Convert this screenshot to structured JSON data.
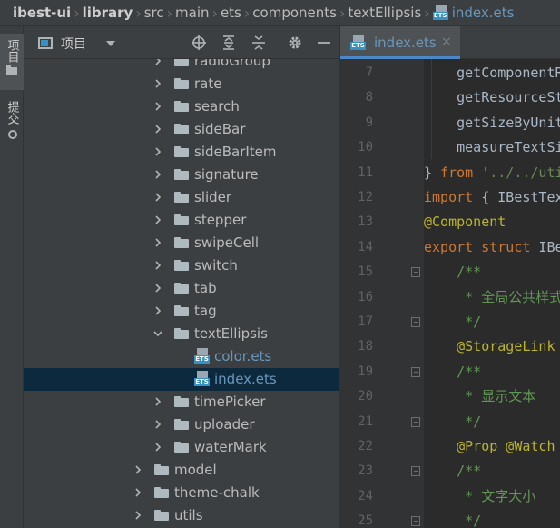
{
  "breadcrumb": {
    "items": [
      "ibest-ui",
      "library",
      "src",
      "main",
      "ets",
      "components",
      "textEllipsis",
      "index.ets"
    ]
  },
  "tool_strip": {
    "project_label": "项目",
    "commit_label": "提交"
  },
  "project_panel": {
    "title": "项目",
    "tree": [
      {
        "label": "radioGroup",
        "type": "folder",
        "depth": 2,
        "expanded": false,
        "selected": false
      },
      {
        "label": "rate",
        "type": "folder",
        "depth": 2,
        "expanded": false,
        "selected": false
      },
      {
        "label": "search",
        "type": "folder",
        "depth": 2,
        "expanded": false,
        "selected": false
      },
      {
        "label": "sideBar",
        "type": "folder",
        "depth": 2,
        "expanded": false,
        "selected": false
      },
      {
        "label": "sideBarItem",
        "type": "folder",
        "depth": 2,
        "expanded": false,
        "selected": false
      },
      {
        "label": "signature",
        "type": "folder",
        "depth": 2,
        "expanded": false,
        "selected": false
      },
      {
        "label": "slider",
        "type": "folder",
        "depth": 2,
        "expanded": false,
        "selected": false
      },
      {
        "label": "stepper",
        "type": "folder",
        "depth": 2,
        "expanded": false,
        "selected": false
      },
      {
        "label": "swipeCell",
        "type": "folder",
        "depth": 2,
        "expanded": false,
        "selected": false
      },
      {
        "label": "switch",
        "type": "folder",
        "depth": 2,
        "expanded": false,
        "selected": false
      },
      {
        "label": "tab",
        "type": "folder",
        "depth": 2,
        "expanded": false,
        "selected": false
      },
      {
        "label": "tag",
        "type": "folder",
        "depth": 2,
        "expanded": false,
        "selected": false
      },
      {
        "label": "textEllipsis",
        "type": "folder",
        "depth": 2,
        "expanded": true,
        "selected": false
      },
      {
        "label": "color.ets",
        "type": "file",
        "depth": 3,
        "expanded": false,
        "selected": false
      },
      {
        "label": "index.ets",
        "type": "file",
        "depth": 3,
        "expanded": false,
        "selected": true
      },
      {
        "label": "timePicker",
        "type": "folder",
        "depth": 2,
        "expanded": false,
        "selected": false
      },
      {
        "label": "uploader",
        "type": "folder",
        "depth": 2,
        "expanded": false,
        "selected": false
      },
      {
        "label": "waterMark",
        "type": "folder",
        "depth": 2,
        "expanded": false,
        "selected": false
      },
      {
        "label": "model",
        "type": "folder",
        "depth": 1,
        "expanded": false,
        "selected": false
      },
      {
        "label": "theme-chalk",
        "type": "folder",
        "depth": 1,
        "expanded": false,
        "selected": false
      },
      {
        "label": "utils",
        "type": "folder",
        "depth": 1,
        "expanded": false,
        "selected": false
      }
    ]
  },
  "editor": {
    "tab_label": "index.ets",
    "tab_close": "×",
    "badge": "ETS",
    "lines": [
      {
        "num": "7",
        "fold": false,
        "tokens": [
          {
            "t": "    getComponentRectByName,",
            "c": "#a9b7c6"
          }
        ]
      },
      {
        "num": "8",
        "fold": false,
        "tokens": [
          {
            "t": "    getResourceStr,",
            "c": "#a9b7c6"
          }
        ]
      },
      {
        "num": "9",
        "fold": false,
        "tokens": [
          {
            "t": "    getSizeByUnit,",
            "c": "#a9b7c6"
          }
        ]
      },
      {
        "num": "10",
        "fold": false,
        "tokens": [
          {
            "t": "    measureTextSize",
            "c": "#a9b7c6"
          }
        ]
      },
      {
        "num": "11",
        "fold": false,
        "tokens": [
          {
            "t": "} ",
            "c": "#a9b7c6"
          },
          {
            "t": "from ",
            "c": "#cc7832"
          },
          {
            "t": "'../../utils/utils'",
            "c": "#6a8759"
          }
        ]
      },
      {
        "num": "12",
        "fold": false,
        "tokens": [
          {
            "t": "import ",
            "c": "#cc7832"
          },
          {
            "t": "{ IBestTextEllipsisColor }",
            "c": "#a9b7c6"
          }
        ]
      },
      {
        "num": "13",
        "fold": false,
        "tokens": [
          {
            "t": "@Component",
            "c": "#bbb529"
          }
        ]
      },
      {
        "num": "14",
        "fold": false,
        "tokens": [
          {
            "t": "export ",
            "c": "#cc7832"
          },
          {
            "t": "struct ",
            "c": "#cc7832"
          },
          {
            "t": "IBestTextEllipsis",
            "c": "#a9b7c6"
          }
        ]
      },
      {
        "num": "15",
        "fold": true,
        "tokens": [
          {
            "t": "    /**",
            "c": "#629755"
          }
        ]
      },
      {
        "num": "16",
        "fold": false,
        "tokens": [
          {
            "t": "     * 全局公共样式",
            "c": "#629755"
          }
        ]
      },
      {
        "num": "17",
        "fold": true,
        "tokens": [
          {
            "t": "     */",
            "c": "#629755"
          }
        ]
      },
      {
        "num": "18",
        "fold": false,
        "tokens": [
          {
            "t": "    @StorageLink",
            "c": "#bbb529"
          }
        ]
      },
      {
        "num": "19",
        "fold": true,
        "tokens": [
          {
            "t": "    /**",
            "c": "#629755"
          }
        ]
      },
      {
        "num": "20",
        "fold": false,
        "tokens": [
          {
            "t": "     * 显示文本",
            "c": "#629755"
          }
        ]
      },
      {
        "num": "21",
        "fold": true,
        "tokens": [
          {
            "t": "     */",
            "c": "#629755"
          }
        ]
      },
      {
        "num": "22",
        "fold": false,
        "tokens": [
          {
            "t": "    @Prop @Watch",
            "c": "#bbb529"
          }
        ]
      },
      {
        "num": "23",
        "fold": true,
        "tokens": [
          {
            "t": "    /**",
            "c": "#629755"
          }
        ]
      },
      {
        "num": "24",
        "fold": false,
        "tokens": [
          {
            "t": "     * 文字大小",
            "c": "#629755"
          }
        ]
      },
      {
        "num": "25",
        "fold": true,
        "tokens": [
          {
            "t": "     */",
            "c": "#629755"
          }
        ]
      }
    ]
  },
  "colors": {
    "selection": "#0d293e",
    "accent": "#4a88c7",
    "file_text": "#6897bb",
    "ets_badge": "#3592c4"
  }
}
